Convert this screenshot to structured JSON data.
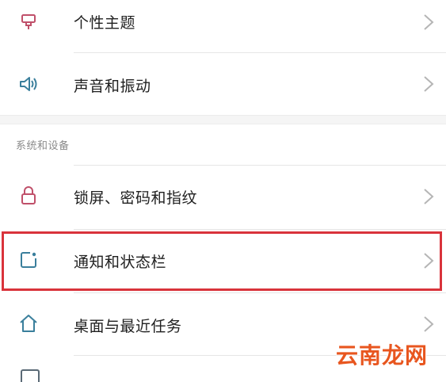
{
  "settings": {
    "items": [
      {
        "label": "个性主题",
        "icon": "theme-brush-icon"
      },
      {
        "label": "声音和振动",
        "icon": "speaker-icon"
      },
      {
        "label": "锁屏、密码和指纹",
        "icon": "lock-icon"
      },
      {
        "label": "通知和状态栏",
        "icon": "notification-icon"
      },
      {
        "label": "桌面与最近任务",
        "icon": "home-icon"
      }
    ],
    "section_header": "系统和设备"
  },
  "colors": {
    "highlight": "#d9333b",
    "icon_teal": "#3a7f9c",
    "icon_pink": "#c0506a",
    "watermark": "#e8561f"
  },
  "watermark": {
    "text": "云南龙网"
  }
}
